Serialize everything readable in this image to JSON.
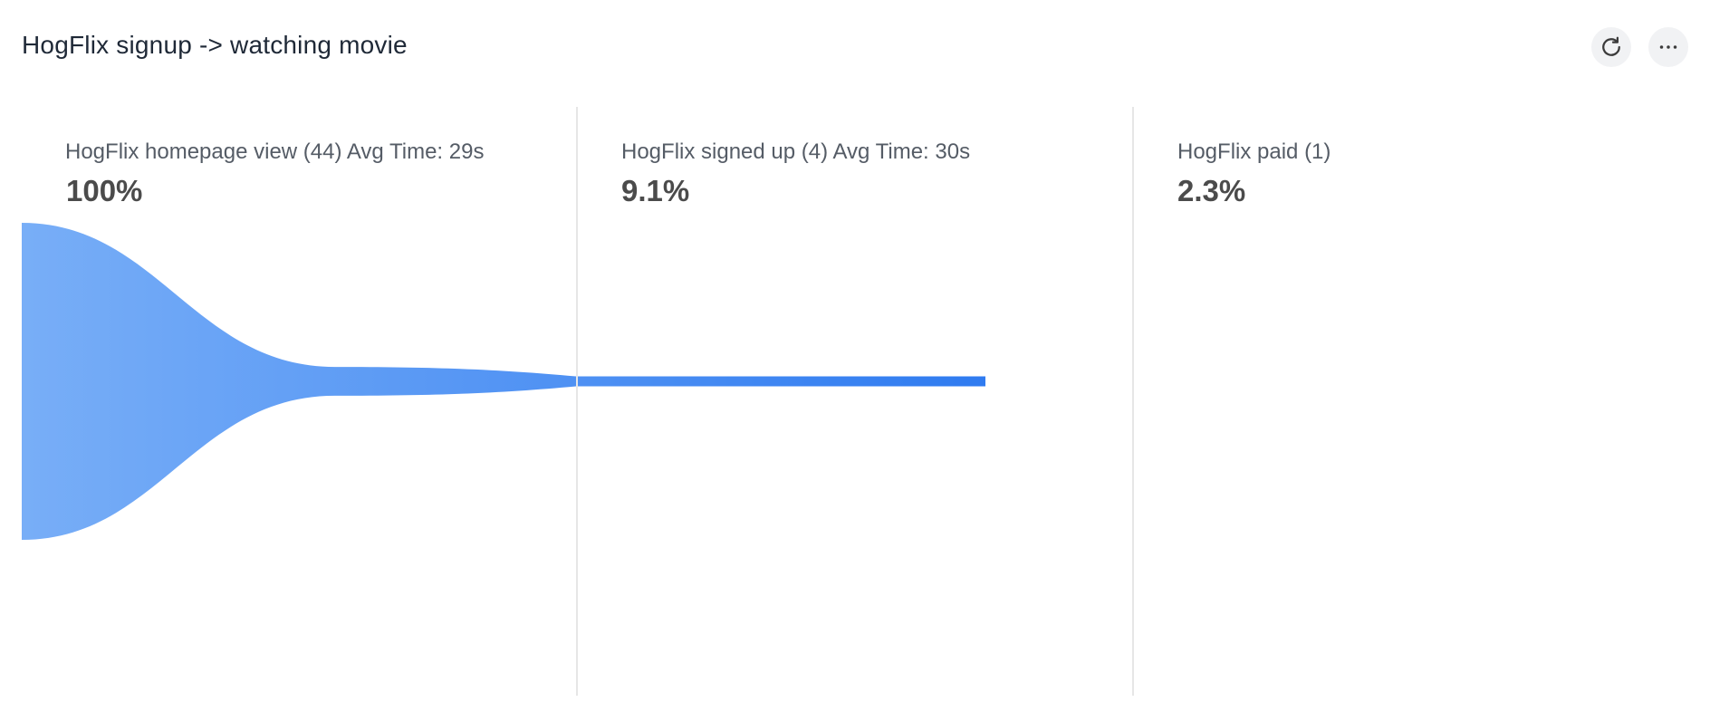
{
  "insight": {
    "title": "HogFlix signup -> watching movie",
    "actions": {
      "refresh": "refresh-icon",
      "more": "more-horizontal-icon"
    }
  },
  "steps": [
    {
      "label": "HogFlix homepage view (44) Avg Time: 29s",
      "percent": "100%"
    },
    {
      "label": "HogFlix signed up (4) Avg Time: 30s",
      "percent": "9.1%"
    },
    {
      "label": "HogFlix paid (1)",
      "percent": "2.3%"
    }
  ],
  "chart_data": {
    "type": "area",
    "categories": [
      "HogFlix homepage view",
      "HogFlix signed up",
      "HogFlix paid"
    ],
    "values": [
      44,
      4,
      1
    ],
    "percentages": [
      100,
      9.1,
      2.3
    ],
    "colors": {
      "start": "#78aef7",
      "end": "#2f7bf0"
    }
  }
}
